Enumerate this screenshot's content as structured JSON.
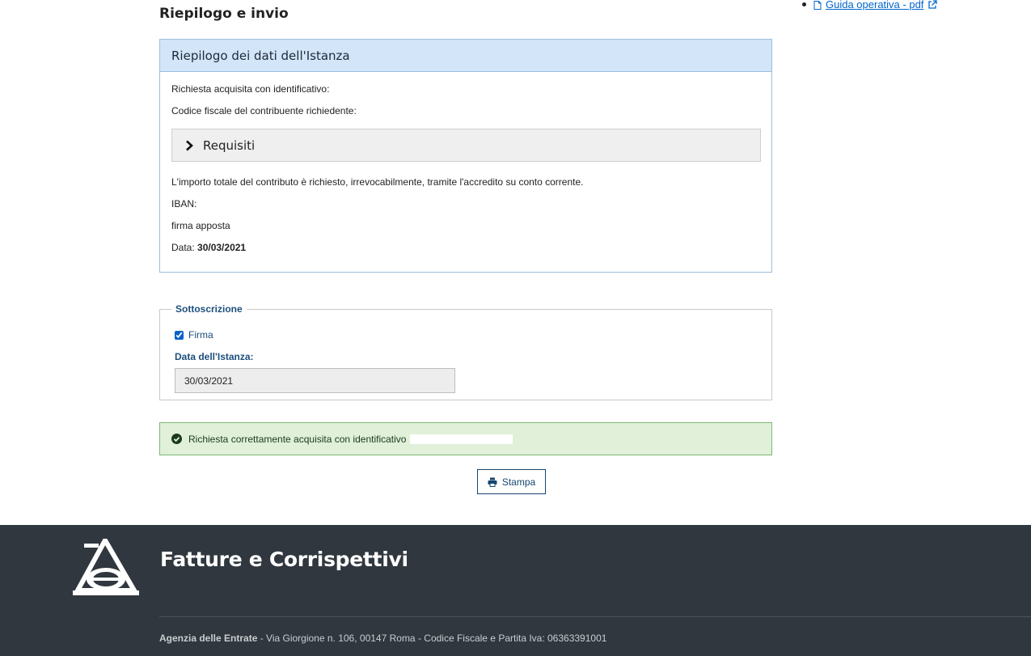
{
  "page": {
    "title": "Riepilogo e invio"
  },
  "side_links": [
    {
      "label": "Guida operativa - pdf",
      "icon": "pdf-icon",
      "ext_icon": "external-link-icon"
    }
  ],
  "summary": {
    "title": "Riepilogo dei dati dell'Istanza",
    "identificativo_label": "Richiesta acquisita con identificativo:",
    "codice_fiscale_label": "Codice fiscale del contribuente richiedente:",
    "requisiti_label": "Requisiti",
    "importo_text": "L'importo totale del contributo è richiesto, irrevocabilmente, tramite l'accredito su conto corrente.",
    "iban_label": "IBAN:",
    "firma_text": "firma apposta",
    "data_label": "Data:",
    "data_value": "30/03/2021"
  },
  "sottoscrizione": {
    "legend": "Sottoscrizione",
    "firma_label": "Firma",
    "firma_checked": true,
    "data_istanza_label": "Data dell'Istanza:",
    "data_istanza_value": "30/03/2021"
  },
  "alert": {
    "text": "Richiesta correttamente acquisita con identificativo",
    "icon": "check-circle-icon",
    "color": "#e0f0d9"
  },
  "actions": {
    "stampa_label": "Stampa",
    "icon": "printer-icon"
  },
  "footer": {
    "title": "Fatture e Corrispettivi",
    "org": "Agenzia delle Entrate",
    "address": " - Via Giorgione n. 106, 00147 Roma - Codice Fiscale e Partita Iva: 06363391001",
    "background": "#30373e"
  }
}
